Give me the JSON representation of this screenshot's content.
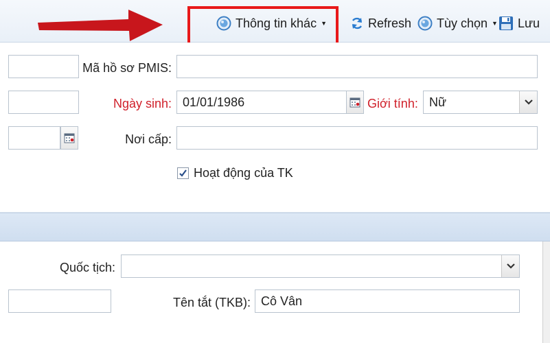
{
  "toolbar": {
    "other_info_label": "Thông tin khác",
    "refresh_label": "Refresh",
    "options_label": "Tùy chọn",
    "save_label": "Lưu"
  },
  "form1": {
    "pmis_label": "Mã hồ sơ PMIS:",
    "pmis_value": "",
    "birthdate_label": "Ngày sinh:",
    "birthdate_value": "01/01/1986",
    "gender_label": "Giới tính:",
    "gender_value": "Nữ",
    "issue_place_label": "Nơi cấp:",
    "issue_place_value": "",
    "active_label": "Hoạt động của TK",
    "active_checked": true
  },
  "form2": {
    "nationality_label": "Quốc tịch:",
    "nationality_value": "",
    "short_name_label": "Tên tắt (TKB):",
    "short_name_value": "Cô Vân"
  },
  "colors": {
    "required_label": "#d0202a",
    "highlight_box": "#e8191a",
    "arrow": "#c8161c",
    "accent": "#1a73c8"
  }
}
